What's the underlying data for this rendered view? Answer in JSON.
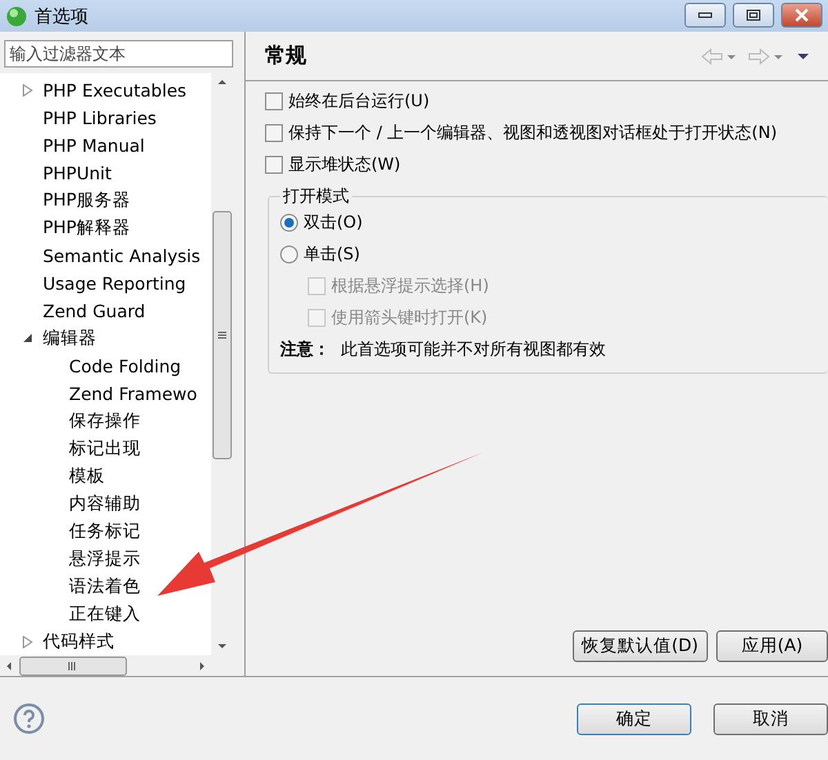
{
  "window": {
    "title": "首选项"
  },
  "filter": {
    "placeholder": "输入过滤器文本"
  },
  "tree": [
    {
      "label": "PHP Executables",
      "expanded": false
    },
    {
      "label": "PHP Libraries"
    },
    {
      "label": "PHP Manual"
    },
    {
      "label": "PHPUnit"
    },
    {
      "label": "PHP服务器"
    },
    {
      "label": "PHP解释器"
    },
    {
      "label": "Semantic Analysis"
    },
    {
      "label": "Usage Reporting"
    },
    {
      "label": "Zend Guard"
    },
    {
      "label": "编辑器",
      "expanded": true,
      "children": [
        {
          "label": "Code Folding"
        },
        {
          "label": "Zend Framewo"
        },
        {
          "label": "保存操作"
        },
        {
          "label": "标记出现"
        },
        {
          "label": "模板"
        },
        {
          "label": "内容辅助"
        },
        {
          "label": "任务标记"
        },
        {
          "label": "悬浮提示"
        },
        {
          "label": "语法着色"
        },
        {
          "label": "正在键入"
        }
      ]
    },
    {
      "label": "代码样式",
      "expanded": false
    }
  ],
  "page": {
    "title": "常规",
    "options": [
      {
        "label": "始终在后台运行(U)",
        "checked": false
      },
      {
        "label": "保持下一个 / 上一个编辑器、视图和透视图对话框处于打开状态(N)",
        "checked": false
      },
      {
        "label": "显示堆状态(W)",
        "checked": false
      }
    ],
    "open_mode": {
      "title": "打开模式",
      "modes": [
        {
          "label": "双击(O)",
          "selected": true
        },
        {
          "label": "单击(S)",
          "selected": false
        }
      ],
      "sub_options": [
        {
          "label": "根据悬浮提示选择(H)",
          "checked": false,
          "disabled": true
        },
        {
          "label": "使用箭头键时打开(K)",
          "checked": false,
          "disabled": true
        }
      ],
      "note_label": "注意：",
      "note": "此首选项可能并不对所有视图都有效"
    },
    "buttons": [
      "恢复默认值(D)",
      "应用(A)"
    ]
  },
  "dialog_buttons": [
    "确定",
    "取消"
  ]
}
